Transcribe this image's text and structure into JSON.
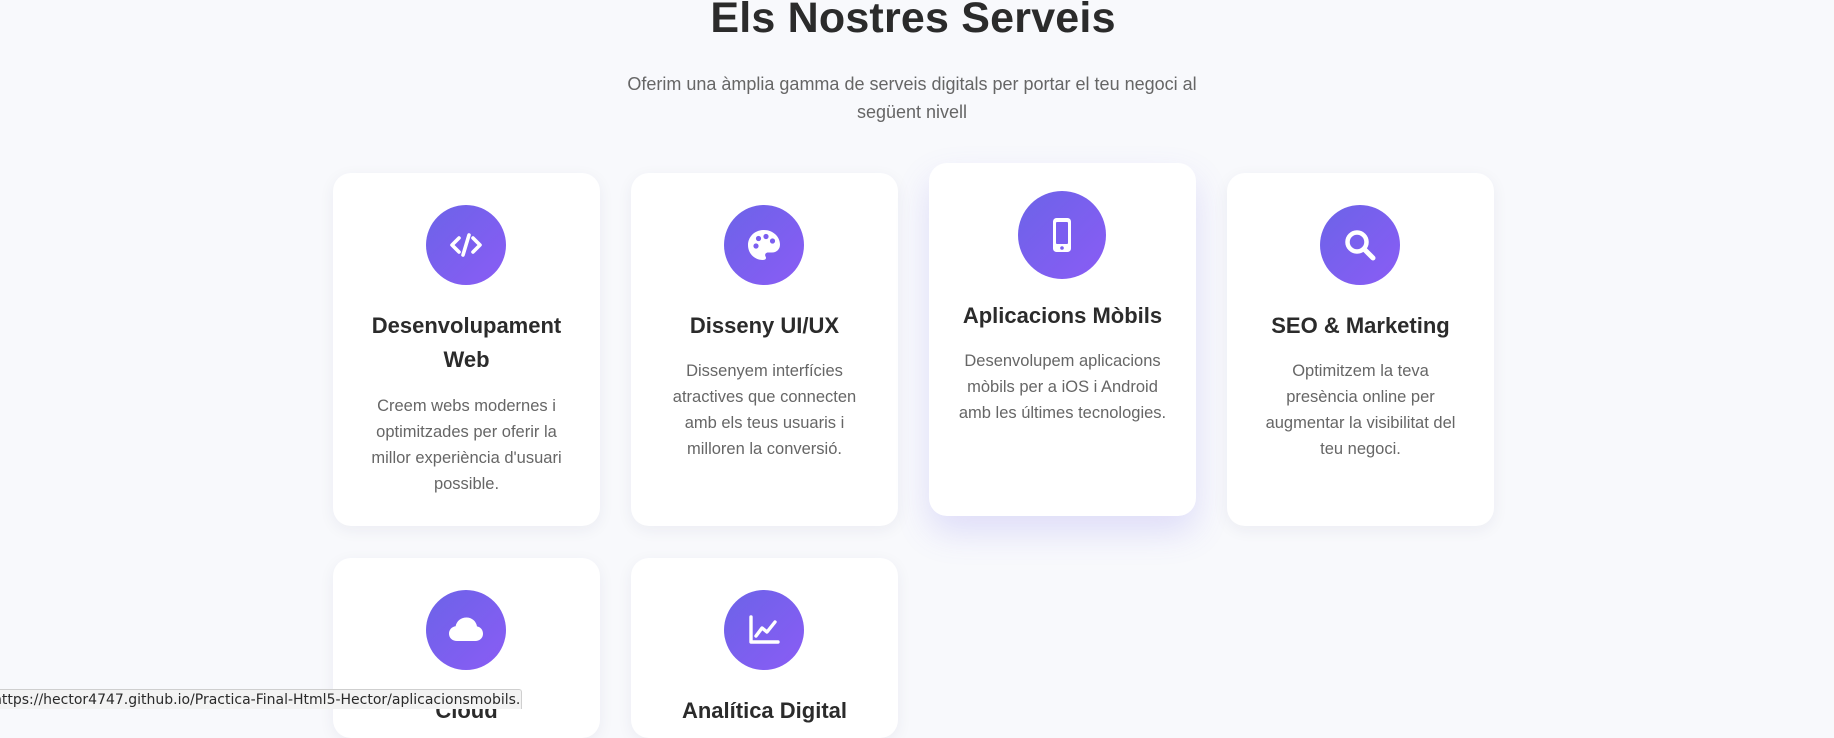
{
  "section": {
    "title": "Els Nostres Serveis",
    "subtitle": "Oferim una àmplia gamma de serveis digitals per portar el teu negoci al següent nivell"
  },
  "services": [
    {
      "icon": "code-icon",
      "title": "Desenvolupament Web",
      "description": "Creem webs modernes i optimitzades per oferir la millor experiència d'usuari possible."
    },
    {
      "icon": "palette-icon",
      "title": "Disseny UI/UX",
      "description": "Dissenyem interfícies atractives que connecten amb els teus usuaris i milloren la conversió."
    },
    {
      "icon": "mobile-icon",
      "title": "Aplicacions Mòbils",
      "description": "Desenvolupem aplicacions mòbils per a iOS i Android amb les últimes tecnologies."
    },
    {
      "icon": "search-icon",
      "title": "SEO & Marketing",
      "description": "Optimitzem la teva presència online per augmentar la visibilitat del teu negoci."
    },
    {
      "icon": "cloud-icon",
      "title": "Cloud",
      "description": ""
    },
    {
      "icon": "chart-line-icon",
      "title": "Analítica Digital",
      "description": ""
    }
  ],
  "status_bar": {
    "url": "https://hector4747.github.io/Practica-Final-Html5-Hector/aplicacionsmobils.html"
  },
  "colors": {
    "accent_start": "#6c63e8",
    "accent_end": "#8a5cf5",
    "background": "#f8f9fc"
  }
}
